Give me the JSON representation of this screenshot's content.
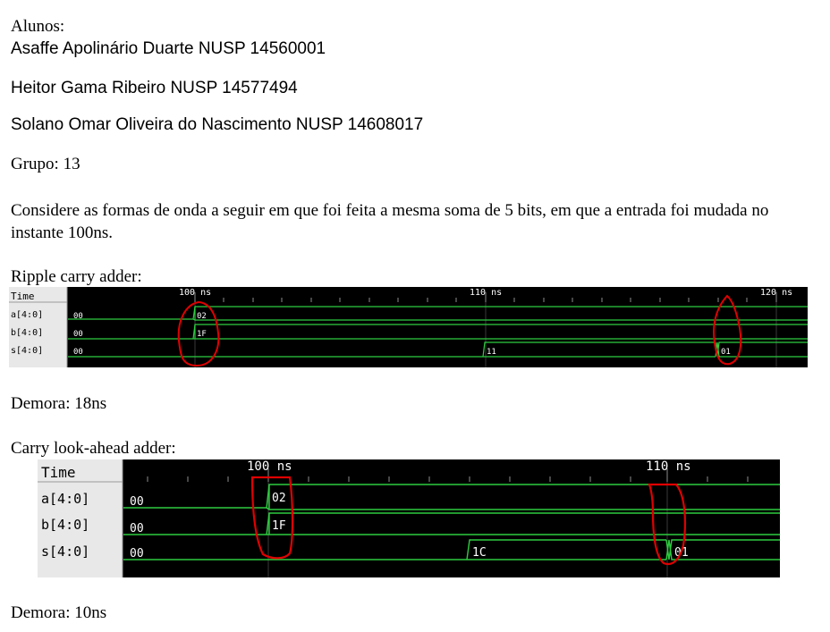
{
  "header": {
    "students_label": "Alunos:",
    "students": [
      "Asaffe Apolinário Duarte NUSP 14560001",
      "Heitor Gama Ribeiro NUSP 14577494",
      "Solano Omar Oliveira do Nascimento NUSP 14608017"
    ],
    "group": "Grupo: 13"
  },
  "intro": "Considere as formas de onda a seguir em que foi feita a mesma soma de 5 bits, em que a entrada foi mudada no instante 100ns.",
  "ripple": {
    "heading": "Ripple carry adder:",
    "time_label": "Time",
    "ticks": [
      "100 ns",
      "110 ns",
      "120 ns"
    ],
    "signals": [
      {
        "name": "a[4:0]",
        "v0": "00",
        "v1": "02"
      },
      {
        "name": "b[4:0]",
        "v0": "00",
        "v1": "1F"
      },
      {
        "name": "s[4:0]",
        "v0": "00",
        "v1": "11",
        "v2": "01"
      }
    ],
    "delay": "Demora: 18ns"
  },
  "cla": {
    "heading": "Carry look-ahead adder:",
    "time_label": "Time",
    "ticks": [
      "100 ns",
      "110 ns"
    ],
    "signals": [
      {
        "name": "a[4:0]",
        "v0": "00",
        "v1": "02"
      },
      {
        "name": "b[4:0]",
        "v0": "00",
        "v1": "1F"
      },
      {
        "name": "s[4:0]",
        "v0": "00",
        "v1": "1C",
        "v2": "01"
      }
    ],
    "delay": "Demora: 10ns"
  },
  "colors": {
    "wave": "#2ecc40",
    "annotation": "#e00000",
    "background": "#000000",
    "label_panel": "#e8e8e8"
  }
}
